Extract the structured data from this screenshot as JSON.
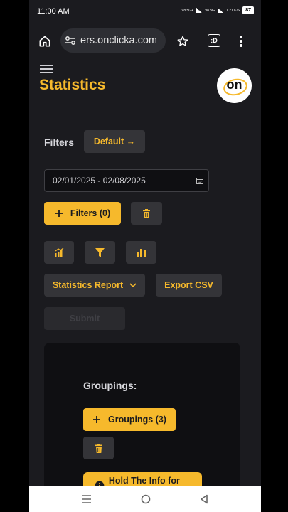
{
  "status_bar": {
    "time": "11:00 AM",
    "net1": "Vo 5G+",
    "net2": "Vo 5G",
    "speed": "1.21 K/S",
    "battery": "87"
  },
  "browser": {
    "url": "ers.onclicka.com",
    "tabs_label": ":D"
  },
  "page": {
    "title": "Statistics",
    "logo_text": "on",
    "filters_label": "Filters",
    "default_button": "Default →",
    "date_range": "02/01/2025 - 02/08/2025",
    "filters_button": "Filters (0)",
    "report_select": "Statistics Report",
    "export_button": "Export CSV",
    "submit_button": "Submit",
    "groupings_label": "Groupings:",
    "groupings_button": "Groupings (3)",
    "bottom_button": "Hold The Info for the..."
  },
  "colors": {
    "accent": "#f6b92c",
    "background": "#1b1b1f",
    "button_dark": "#343438"
  },
  "icons": [
    "home-icon",
    "tune-icon",
    "star-icon",
    "more-vert-icon",
    "calendar-icon",
    "plus-icon",
    "trash-icon",
    "chart-icon",
    "funnel-icon",
    "bar-chart-icon"
  ]
}
